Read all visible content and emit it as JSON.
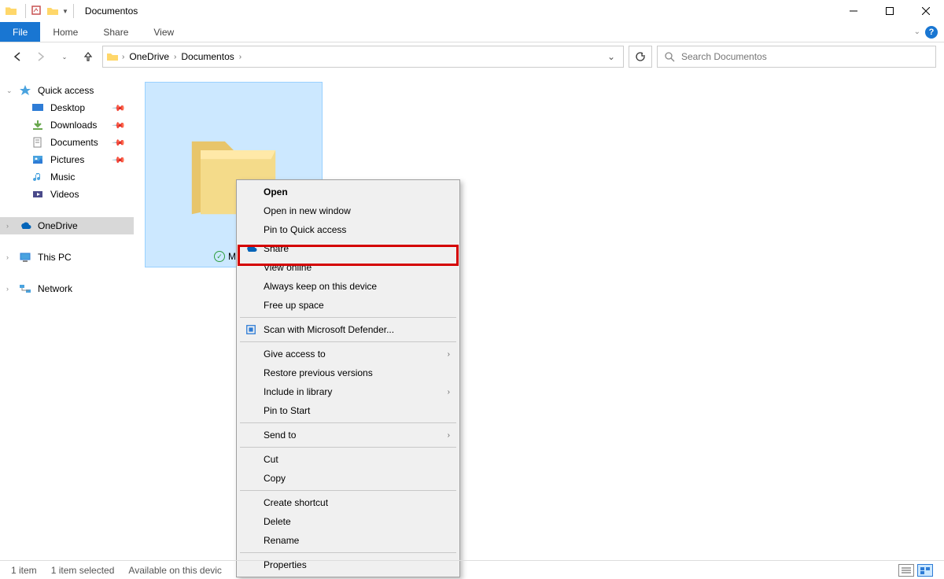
{
  "title": "Documentos",
  "ribbon": {
    "file": "File",
    "tabs": [
      "Home",
      "Share",
      "View"
    ]
  },
  "breadcrumb": [
    "OneDrive",
    "Documentos"
  ],
  "search_placeholder": "Search Documentos",
  "sidebar": {
    "quick_access": "Quick access",
    "items": [
      {
        "label": "Desktop",
        "pinned": true
      },
      {
        "label": "Downloads",
        "pinned": true
      },
      {
        "label": "Documents",
        "pinned": true
      },
      {
        "label": "Pictures",
        "pinned": true
      },
      {
        "label": "Music",
        "pinned": false
      },
      {
        "label": "Videos",
        "pinned": false
      }
    ],
    "onedrive": "OneDrive",
    "this_pc": "This PC",
    "network": "Network"
  },
  "folder": {
    "name": "Malav"
  },
  "context_menu": {
    "open": "Open",
    "open_new": "Open in new window",
    "pin_qa": "Pin to Quick access",
    "share": "Share",
    "view_online": "View online",
    "always_keep": "Always keep on this device",
    "free_up": "Free up space",
    "scan": "Scan with Microsoft Defender...",
    "give_access": "Give access to",
    "restore": "Restore previous versions",
    "include_lib": "Include in library",
    "pin_start": "Pin to Start",
    "send_to": "Send to",
    "cut": "Cut",
    "copy": "Copy",
    "create_shortcut": "Create shortcut",
    "delete": "Delete",
    "rename": "Rename",
    "properties": "Properties"
  },
  "status": {
    "count": "1 item",
    "selected": "1 item selected",
    "avail": "Available on this devic"
  }
}
